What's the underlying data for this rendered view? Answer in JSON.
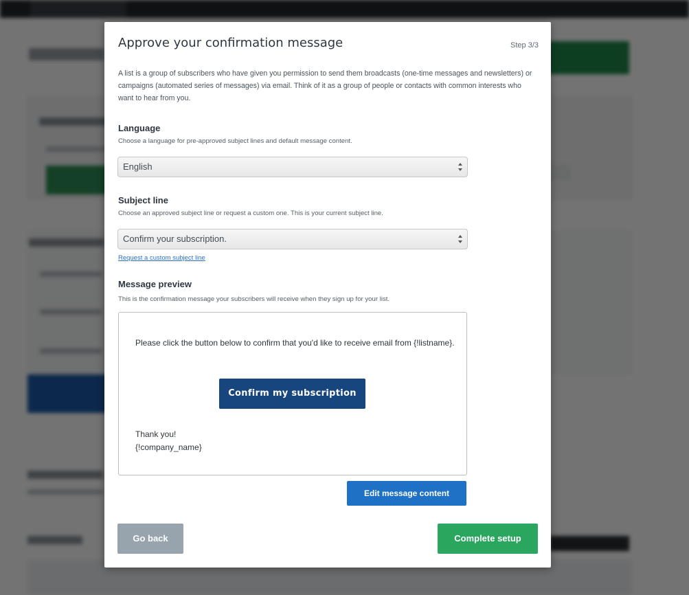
{
  "modal": {
    "title": "Approve your confirmation message",
    "step": "Step 3/3",
    "intro": "A list is a group of subscribers who have given you permission to send them broadcasts (one-time messages and newsletters) or campaigns (automated series of messages) via email. Think of it as a group of people or contacts with common interests who want to hear from you."
  },
  "language": {
    "title": "Language",
    "help": "Choose a language for pre-approved subject lines and default message content.",
    "selected": "English"
  },
  "subject": {
    "title": "Subject line",
    "help": "Choose an approved subject line or request a custom one. This is your current subject line.",
    "selected": "Confirm your subscription.",
    "custom_link": "Request a custom subject line"
  },
  "preview": {
    "title": "Message preview",
    "help": "This is the confirmation message your subscribers will receive when they sign up for your list.",
    "body": "Please click the button below to confirm that you'd like to receive email from {!listname}.",
    "button": "Confirm my subscription",
    "thanks": "Thank you!",
    "signature": "{!company_name}"
  },
  "actions": {
    "edit": "Edit message content",
    "back": "Go back",
    "complete": "Complete setup"
  },
  "colors": {
    "confirm_button": "#17457d",
    "edit_button": "#1f71c5",
    "back_button": "#97a4ae",
    "complete_button": "#2aa65e"
  },
  "icons": {
    "select_arrows": "up-down-arrows-icon"
  }
}
